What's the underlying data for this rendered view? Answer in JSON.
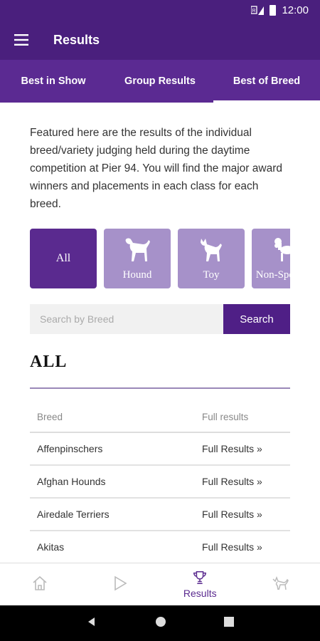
{
  "status_bar": {
    "time": "12:00"
  },
  "app_bar": {
    "title": "Results"
  },
  "tabs": [
    {
      "label": "Best in Show"
    },
    {
      "label": "Group Results"
    },
    {
      "label": "Best of Breed",
      "active": true
    }
  ],
  "intro_text": "Featured here are the results of the individual breed/variety judging held during the daytime competition at Pier 94. You will find the major award winners and placements in each class for each breed.",
  "categories": [
    {
      "label": "All",
      "active": true
    },
    {
      "label": "Hound",
      "icon": "hound-icon"
    },
    {
      "label": "Toy",
      "icon": "toy-dog-icon"
    },
    {
      "label": "Non-Sporting",
      "icon": "poodle-icon"
    }
  ],
  "search": {
    "placeholder": "Search by Breed",
    "button_label": "Search"
  },
  "section_title": "ALL",
  "table": {
    "headers": [
      "Breed",
      "Full results"
    ],
    "rows": [
      {
        "breed": "Affenpinschers",
        "link": "Full Results »"
      },
      {
        "breed": "Afghan Hounds",
        "link": "Full Results »"
      },
      {
        "breed": "Airedale Terriers",
        "link": "Full Results »"
      },
      {
        "breed": "Akitas",
        "link": "Full Results »"
      }
    ]
  },
  "bottom_nav": [
    {
      "icon": "home-icon",
      "label": ""
    },
    {
      "icon": "play-icon",
      "label": ""
    },
    {
      "icon": "trophy-icon",
      "label": "Results",
      "active": true
    },
    {
      "icon": "dog-icon",
      "label": ""
    }
  ],
  "colors": {
    "primary": "#4a1f7d",
    "tab_bar": "#5b2a92",
    "category_inactive": "#a691c9",
    "category_active": "#5a2a8f"
  }
}
